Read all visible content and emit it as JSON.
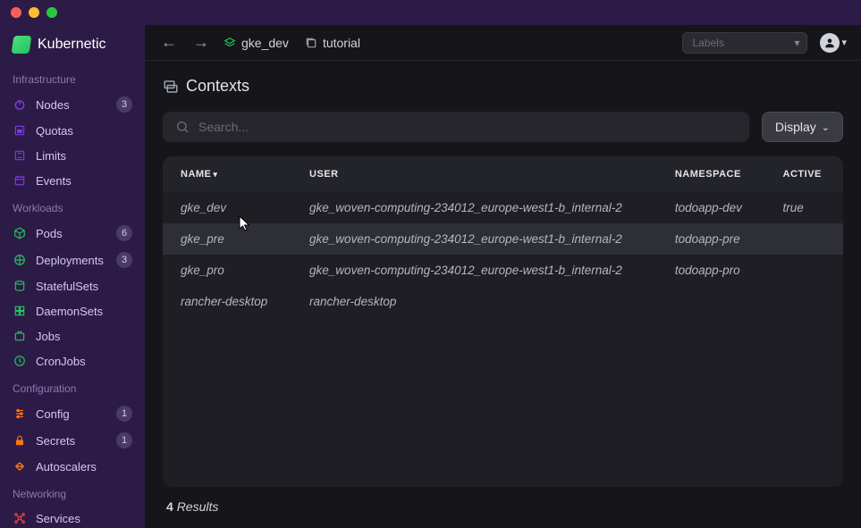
{
  "brand": "Kubernetic",
  "breadcrumbs": [
    {
      "icon": "layers",
      "label": "gke_dev"
    },
    {
      "icon": "stack",
      "label": "tutorial"
    }
  ],
  "labels_placeholder": "Labels",
  "page_title": "Contexts",
  "search_placeholder": "Search...",
  "display_button": "Display",
  "sidebar": {
    "groups": [
      {
        "header": "Infrastructure",
        "items": [
          {
            "icon": "power",
            "color": "#7c3aed",
            "label": "Nodes",
            "badge": "3"
          },
          {
            "icon": "quota",
            "color": "#7c3aed",
            "label": "Quotas"
          },
          {
            "icon": "limit",
            "color": "#7c3aed",
            "label": "Limits"
          },
          {
            "icon": "event",
            "color": "#7c3aed",
            "label": "Events"
          }
        ]
      },
      {
        "header": "Workloads",
        "items": [
          {
            "icon": "cube",
            "color": "#22c55e",
            "label": "Pods",
            "badge": "6"
          },
          {
            "icon": "deploy",
            "color": "#22c55e",
            "label": "Deployments",
            "badge": "3"
          },
          {
            "icon": "stateful",
            "color": "#22c55e",
            "label": "StatefulSets"
          },
          {
            "icon": "daemon",
            "color": "#22c55e",
            "label": "DaemonSets"
          },
          {
            "icon": "job",
            "color": "#22c55e",
            "label": "Jobs"
          },
          {
            "icon": "cron",
            "color": "#22c55e",
            "label": "CronJobs"
          }
        ]
      },
      {
        "header": "Configuration",
        "items": [
          {
            "icon": "config",
            "color": "#f97316",
            "label": "Config",
            "badge": "1"
          },
          {
            "icon": "secret",
            "color": "#f97316",
            "label": "Secrets",
            "badge": "1"
          },
          {
            "icon": "scale",
            "color": "#f97316",
            "label": "Autoscalers"
          }
        ]
      },
      {
        "header": "Networking",
        "items": [
          {
            "icon": "service",
            "color": "#ef4444",
            "label": "Services"
          }
        ]
      }
    ]
  },
  "table": {
    "columns": [
      "NAME",
      "USER",
      "NAMESPACE",
      "ACTIVE"
    ],
    "rows": [
      {
        "name": "gke_dev",
        "user": "gke_woven-computing-234012_europe-west1-b_internal-2",
        "namespace": "todoapp-dev",
        "active": "true"
      },
      {
        "name": "gke_pre",
        "user": "gke_woven-computing-234012_europe-west1-b_internal-2",
        "namespace": "todoapp-pre",
        "active": "",
        "hovered": true
      },
      {
        "name": "gke_pro",
        "user": "gke_woven-computing-234012_europe-west1-b_internal-2",
        "namespace": "todoapp-pro",
        "active": ""
      },
      {
        "name": "rancher-desktop",
        "user": "rancher-desktop",
        "namespace": "",
        "active": ""
      }
    ]
  },
  "results": {
    "count": "4",
    "label": "Results"
  }
}
